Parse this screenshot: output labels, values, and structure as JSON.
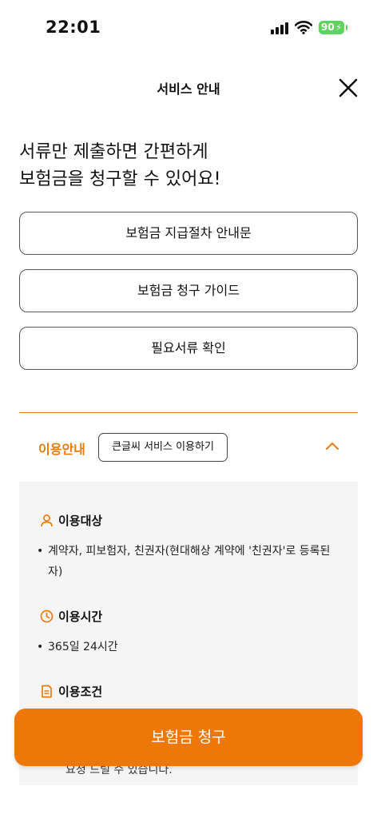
{
  "status_bar": {
    "time": "22:01",
    "battery": "90"
  },
  "header": {
    "title": "서비스 안내"
  },
  "headline": {
    "line1": "서류만 제출하면 간편하게",
    "line2": "보험금을 청구할 수 있어요!"
  },
  "menu": [
    {
      "label": "보험금 지급절차 안내문"
    },
    {
      "label": "보험금 청구 가이드"
    },
    {
      "label": "필요서류 확인"
    }
  ],
  "info": {
    "title": "이용안내",
    "big_font_button": "큰글씨 서비스 이용하기",
    "sections": [
      {
        "heading": "이용대상",
        "icon": "person-icon",
        "items": [
          "계약자, 피보험자, 친권자(현대해상 계약에 '친권자'로 등록된 자)"
        ]
      },
      {
        "heading": "이용시간",
        "icon": "clock-icon",
        "items": [
          "365일 24시간"
        ]
      },
      {
        "heading": "이용조건",
        "icon": "document-icon",
        "items": []
      }
    ],
    "tail_text": "요청 드릴 수 있습니다."
  },
  "cta": {
    "label": "보험금 청구"
  },
  "colors": {
    "accent": "#ee7706",
    "battery": "#5fd35f",
    "panel_bg": "#f5f5f5"
  }
}
